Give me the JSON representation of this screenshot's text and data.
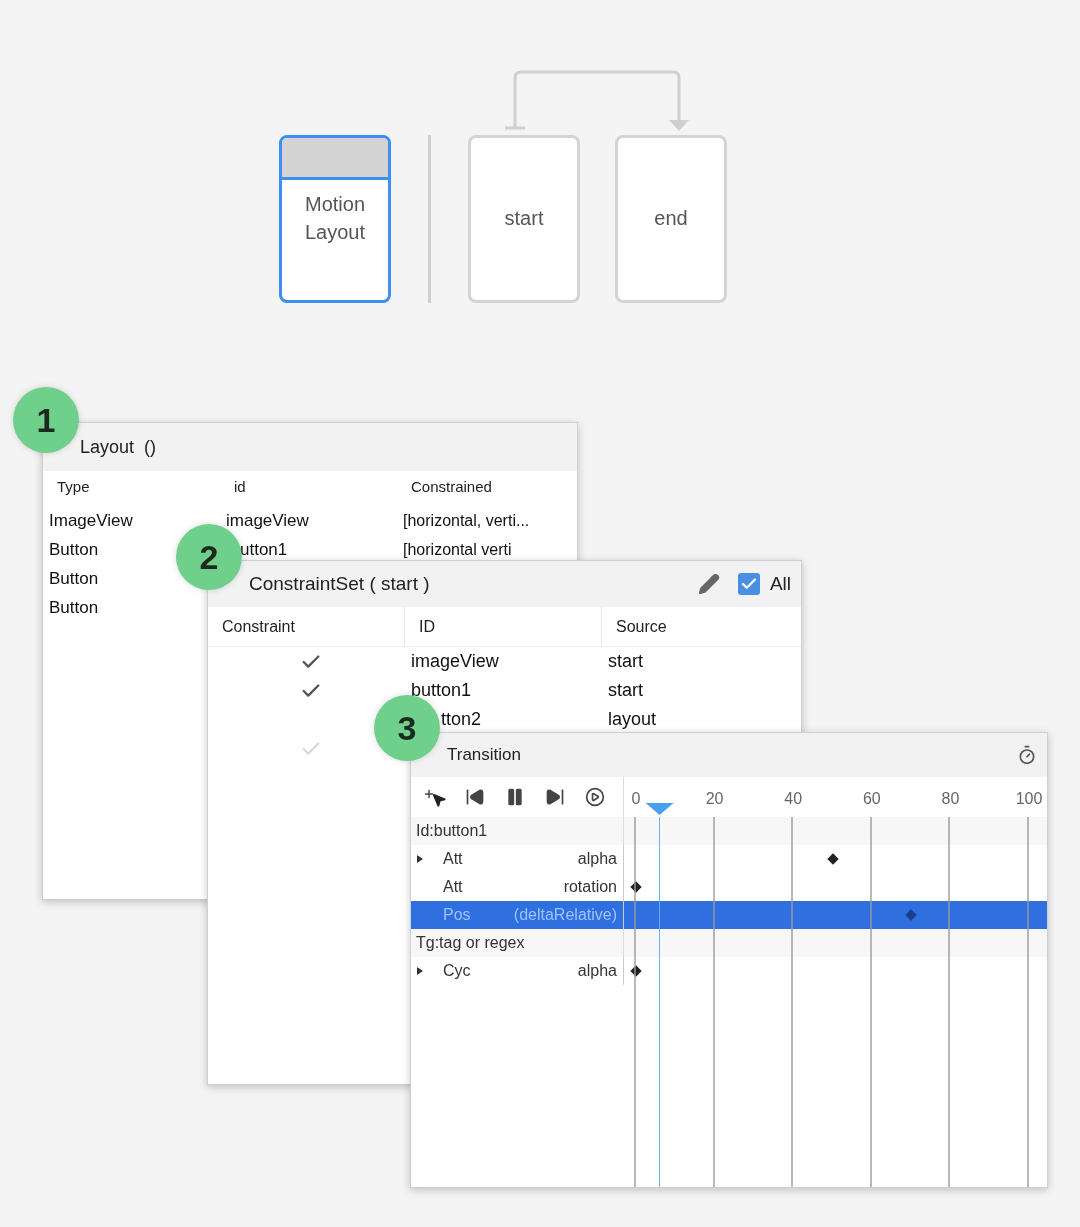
{
  "diagram": {
    "nodes": [
      {
        "kind": "layout",
        "label": "Motion Layout",
        "selected": true
      },
      {
        "kind": "constraint_set",
        "label": "start",
        "selected": false
      },
      {
        "kind": "constraint_set",
        "label": "end",
        "selected": false
      }
    ]
  },
  "layout_panel": {
    "badge": "1",
    "title": "Layout  ()",
    "columns": [
      "Type",
      "id",
      "Constrained"
    ],
    "rows": [
      [
        "ImageView",
        "imageView",
        "[horizontal, verti..."
      ],
      [
        "Button",
        "utton1",
        "[horizontal  verti"
      ],
      [
        "Button"
      ],
      [
        "Button"
      ]
    ]
  },
  "constraint_panel": {
    "badge": "2",
    "title": "ConstraintSet ( start )",
    "all": {
      "label": "All",
      "checked": true
    },
    "columns": [
      "Constraint",
      "ID",
      "Source"
    ],
    "rows": [
      {
        "checked": true,
        "derived": false,
        "id": "imageView",
        "source": "start"
      },
      {
        "checked": true,
        "derived": false,
        "id": "button1",
        "source": "start"
      },
      {
        "checked": false,
        "derived": false,
        "id": "tton2",
        "source": "layout"
      },
      {
        "checked": true,
        "derived": true
      }
    ]
  },
  "transition_panel": {
    "badge": "3",
    "title": "Transition",
    "ticks": [
      "0",
      "20",
      "40",
      "60",
      "80",
      "100"
    ],
    "playhead": {
      "level": 0.06
    },
    "rows": [
      {
        "kind": "group",
        "label": "Id:button1"
      },
      {
        "kind": "track",
        "type": "Att",
        "attribute": "alpha",
        "expandable": true,
        "selected": false,
        "keyframes": [
          {
            "level": 0.5
          }
        ]
      },
      {
        "kind": "track",
        "type": "Att",
        "attribute": "rotation",
        "expandable": false,
        "selected": false,
        "keyframes": [
          {
            "level": 0
          }
        ]
      },
      {
        "kind": "track",
        "type": "Pos",
        "attribute": "(deltaRelative)",
        "expandable": false,
        "selected": true,
        "keyframes": [
          {
            "level": 0.7
          }
        ]
      },
      {
        "kind": "group",
        "label": "Tg:tag or regex"
      },
      {
        "kind": "track",
        "type": "Cyc",
        "attribute": "alpha",
        "expandable": true,
        "selected": false,
        "keyframes": [
          {
            "level": 0
          }
        ]
      }
    ]
  }
}
